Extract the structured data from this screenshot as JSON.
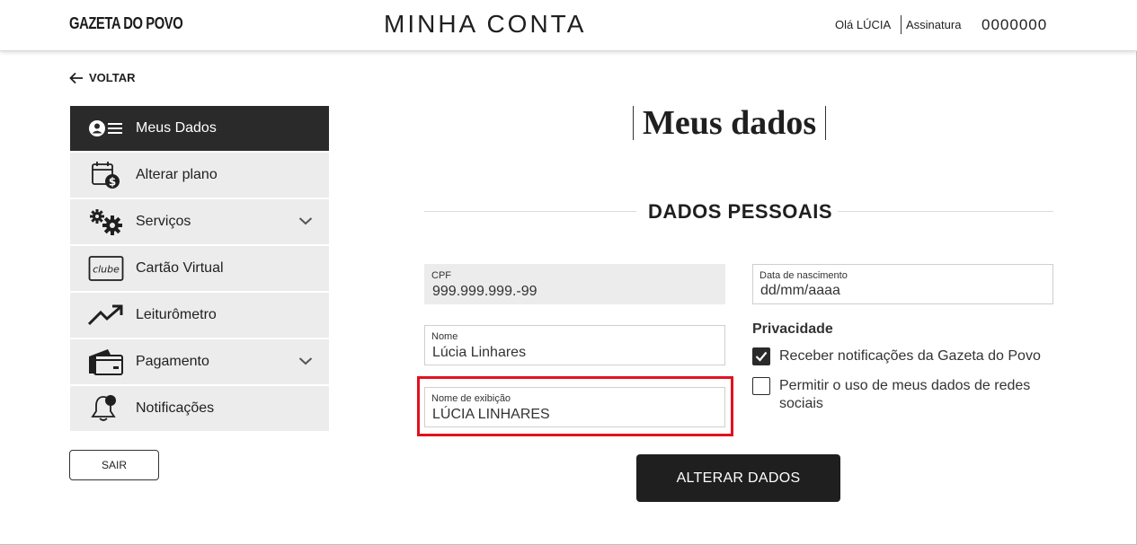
{
  "header": {
    "logo": "GAZETA DO POVO",
    "title": "MINHA CONTA",
    "greeting": "Olá LÚCIA",
    "subscription": "Assinatura",
    "account_number": "0000000"
  },
  "back_label": "VOLTAR",
  "sidebar": {
    "items": [
      {
        "label": "Meus Dados",
        "icon": "user-list-icon",
        "active": true
      },
      {
        "label": "Alterar plano",
        "icon": "calendar-dollar-icon"
      },
      {
        "label": "Serviços",
        "icon": "gears-icon",
        "expandable": true
      },
      {
        "label": "Cartão Virtual",
        "icon": "clube-card-icon"
      },
      {
        "label": "Leiturômetro",
        "icon": "trending-up-icon"
      },
      {
        "label": "Pagamento",
        "icon": "credit-cards-icon",
        "expandable": true
      },
      {
        "label": "Notificações",
        "icon": "bell-icon"
      }
    ],
    "logout_label": "SAIR"
  },
  "main": {
    "title": "Meus dados",
    "section_title": "DADOS PESSOAIS",
    "fields": {
      "cpf": {
        "label": "CPF",
        "value": "999.999.999.-99"
      },
      "birth": {
        "label": "Data de nascimento",
        "placeholder": "dd/mm/aaaa"
      },
      "name": {
        "label": "Nome",
        "value": "Lúcia Linhares"
      },
      "display_name": {
        "label": "Nome de exibição",
        "value": "LÚCIA LINHARES"
      }
    },
    "privacy": {
      "title": "Privacidade",
      "options": [
        {
          "label": "Receber notificações da Gazeta do Povo",
          "checked": true
        },
        {
          "label": "Permitir o uso de meus dados de redes sociais",
          "checked": false
        }
      ]
    },
    "submit_label": "ALTERAR DADOS"
  },
  "colors": {
    "dark": "#2a2a2a",
    "sidebar_bg": "#ececec",
    "highlight": "#e0121f"
  }
}
